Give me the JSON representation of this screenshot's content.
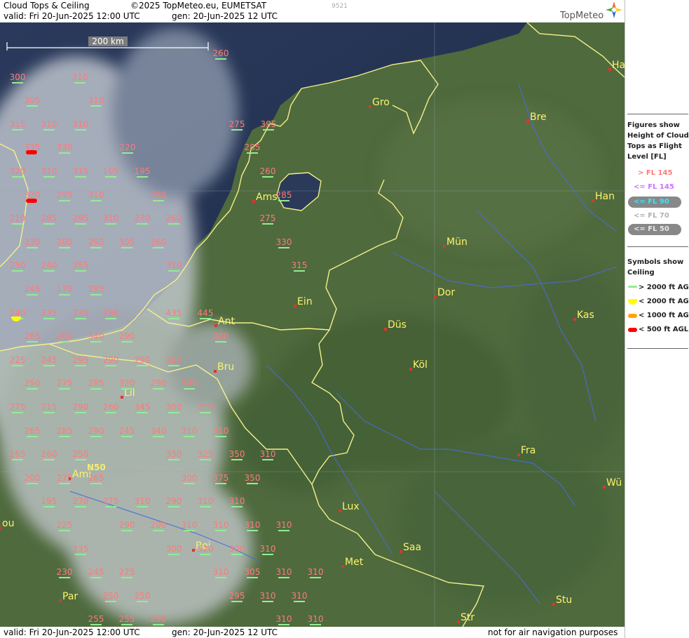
{
  "header": {
    "title": "Cloud Tops & Ceiling",
    "copyright": "©2025 TopMeteo.eu, EUMETSAT",
    "code": "9521",
    "valid": "valid:  Fri   20-Jun-2025  12:00 UTC",
    "gen": "gen: 20-Jun-2025 12 UTC",
    "brand": "TopMeteo"
  },
  "footer": {
    "valid": "valid:  Fri   20-Jun-2025  12:00 UTC",
    "gen": "gen: 20-Jun-2025 12 UTC",
    "disclaimer": "not for air navigation purposes"
  },
  "scale_bar": {
    "label": "200 km"
  },
  "grid_label": "N50",
  "legend": {
    "title_lines": [
      "Figures show",
      "Height of Cloud",
      "Tops as Flight",
      "Level  [FL]"
    ],
    "flight_levels": [
      {
        "label": "> FL 145",
        "color": "#ff7a7a"
      },
      {
        "label": "<= FL 145",
        "color": "#d070ff"
      },
      {
        "label": "<= FL 90",
        "color": "#33e5ff"
      },
      {
        "label": "<= FL 70",
        "color": "#b0b0b0"
      },
      {
        "label": "<= FL 50",
        "color": "#e8e8e8"
      }
    ],
    "symbols_title_lines": [
      "Symbols show",
      "Ceiling"
    ],
    "symbols": [
      {
        "label": "> 2000 ft AGL",
        "color": "#90ee90"
      },
      {
        "label": "< 2000 ft AGL",
        "color": "#ffff00"
      },
      {
        "label": "< 1000 ft AGL",
        "color": "#ffa500"
      },
      {
        "label": "< 500 ft AGL",
        "color": "#ff0000"
      }
    ]
  },
  "cities": [
    {
      "name": "Gro"
    },
    {
      "name": "Bre"
    },
    {
      "name": "Han"
    },
    {
      "name": "Ams"
    },
    {
      "name": "Mün"
    },
    {
      "name": "Dor"
    },
    {
      "name": "Ein"
    },
    {
      "name": "Ant"
    },
    {
      "name": "Düs"
    },
    {
      "name": "Kas"
    },
    {
      "name": "Bru"
    },
    {
      "name": "Köl"
    },
    {
      "name": "Lil"
    },
    {
      "name": "Fra"
    },
    {
      "name": "Ami"
    },
    {
      "name": "Wü"
    },
    {
      "name": "Lux"
    },
    {
      "name": "Rei"
    },
    {
      "name": "Saa"
    },
    {
      "name": "Met"
    },
    {
      "name": "Par"
    },
    {
      "name": "Stu"
    },
    {
      "name": "Str"
    },
    {
      "name": "Ha"
    },
    {
      "name": "ou"
    }
  ],
  "cloud_tops": [
    {
      "v": "260"
    },
    {
      "v": "300"
    },
    {
      "v": "310"
    },
    {
      "v": "305"
    },
    {
      "v": "310"
    },
    {
      "v": "315"
    },
    {
      "v": "310"
    },
    {
      "v": "310"
    },
    {
      "v": "275"
    },
    {
      "v": "395"
    },
    {
      "v": "335"
    },
    {
      "v": "330"
    },
    {
      "v": "220"
    },
    {
      "v": "285"
    },
    {
      "v": "320"
    },
    {
      "v": "310"
    },
    {
      "v": "315"
    },
    {
      "v": "165"
    },
    {
      "v": "195"
    },
    {
      "v": "260"
    },
    {
      "v": "320"
    },
    {
      "v": "295"
    },
    {
      "v": "310"
    },
    {
      "v": "280"
    },
    {
      "v": "285"
    },
    {
      "v": "210"
    },
    {
      "v": "285"
    },
    {
      "v": "295"
    },
    {
      "v": "310"
    },
    {
      "v": "270"
    },
    {
      "v": "260"
    },
    {
      "v": "275"
    },
    {
      "v": "230"
    },
    {
      "v": "200"
    },
    {
      "v": "295"
    },
    {
      "v": "305"
    },
    {
      "v": "260"
    },
    {
      "v": "330"
    },
    {
      "v": "250"
    },
    {
      "v": "240"
    },
    {
      "v": "255"
    },
    {
      "v": "310"
    },
    {
      "v": "315"
    },
    {
      "v": "245"
    },
    {
      "v": "175"
    },
    {
      "v": "285"
    },
    {
      "v": "240"
    },
    {
      "v": "235"
    },
    {
      "v": "275"
    },
    {
      "v": "280"
    },
    {
      "v": "435"
    },
    {
      "v": "445"
    },
    {
      "v": "285"
    },
    {
      "v": "260"
    },
    {
      "v": "340"
    },
    {
      "v": "290"
    },
    {
      "v": "300"
    },
    {
      "v": "225"
    },
    {
      "v": "245"
    },
    {
      "v": "295"
    },
    {
      "v": "290"
    },
    {
      "v": "290"
    },
    {
      "v": "290"
    },
    {
      "v": "250"
    },
    {
      "v": "275"
    },
    {
      "v": "285"
    },
    {
      "v": "320"
    },
    {
      "v": "290"
    },
    {
      "v": "305"
    },
    {
      "v": "275"
    },
    {
      "v": "215"
    },
    {
      "v": "290"
    },
    {
      "v": "260"
    },
    {
      "v": "345"
    },
    {
      "v": "300"
    },
    {
      "v": "310"
    },
    {
      "v": "265"
    },
    {
      "v": "285"
    },
    {
      "v": "290"
    },
    {
      "v": "245"
    },
    {
      "v": "340"
    },
    {
      "v": "310"
    },
    {
      "v": "310"
    },
    {
      "v": "265"
    },
    {
      "v": "260"
    },
    {
      "v": "250"
    },
    {
      "v": "330"
    },
    {
      "v": "325"
    },
    {
      "v": "350"
    },
    {
      "v": "310"
    },
    {
      "v": "200"
    },
    {
      "v": "275"
    },
    {
      "v": "265"
    },
    {
      "v": "300"
    },
    {
      "v": "375"
    },
    {
      "v": "350"
    },
    {
      "v": "195"
    },
    {
      "v": "270"
    },
    {
      "v": "275"
    },
    {
      "v": "310"
    },
    {
      "v": "290"
    },
    {
      "v": "310"
    },
    {
      "v": "310"
    },
    {
      "v": "225"
    },
    {
      "v": "290"
    },
    {
      "v": "200"
    },
    {
      "v": "310"
    },
    {
      "v": "310"
    },
    {
      "v": "310"
    },
    {
      "v": "310"
    },
    {
      "v": "235"
    },
    {
      "v": "300"
    },
    {
      "v": "320"
    },
    {
      "v": "300"
    },
    {
      "v": "310"
    },
    {
      "v": "230"
    },
    {
      "v": "245"
    },
    {
      "v": "275"
    },
    {
      "v": "310"
    },
    {
      "v": "305"
    },
    {
      "v": "310"
    },
    {
      "v": "310"
    },
    {
      "v": "250"
    },
    {
      "v": "250"
    },
    {
      "v": "295"
    },
    {
      "v": "310"
    },
    {
      "v": "310"
    },
    {
      "v": "255"
    },
    {
      "v": "255"
    },
    {
      "v": "230"
    },
    {
      "v": "310"
    },
    {
      "v": "310"
    }
  ],
  "ceiling_markers": [
    {
      "level": "< 500 ft AGL"
    },
    {
      "level": "< 500 ft AGL"
    },
    {
      "level": "< 2000 ft AGL"
    }
  ]
}
